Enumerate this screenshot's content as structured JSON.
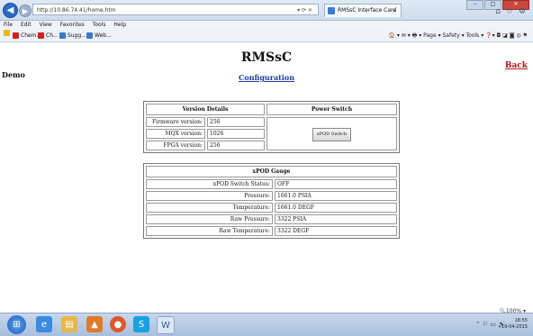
{
  "browser": {
    "url": "http://10.86.74.41/home.htm",
    "tab_title": "RMSsC Interface Card",
    "menu": [
      "File",
      "Edit",
      "View",
      "Favorites",
      "Tools",
      "Help"
    ],
    "favorites": [
      "Chem...",
      "Ch...",
      "Sugg...",
      "Web..."
    ],
    "commands": [
      "Page",
      "Safety",
      "Tools"
    ],
    "zoom": "100%"
  },
  "page": {
    "title": "RMSsC",
    "left_label": "Demo",
    "config_link": "Configuration",
    "back_link": "Back",
    "version_table": {
      "header_left": "Version Details",
      "header_right": "Power Switch",
      "rows": [
        {
          "label": "Firmware version:",
          "value": "256"
        },
        {
          "label": "MQX version:",
          "value": "1026"
        },
        {
          "label": "FPGA version:",
          "value": "256"
        }
      ],
      "switch_button": "xPOD Switch"
    },
    "gauge_table": {
      "header": "xPOD Gauge",
      "rows": [
        {
          "label": "xPOD Switch Status:",
          "value": "OFF"
        },
        {
          "label": "Pressure:",
          "value": "1661.0 PSIA"
        },
        {
          "label": "Temperature:",
          "value": "1661.0 DEGF"
        },
        {
          "label": "Raw Pressure:",
          "value": "3322 PSIA"
        },
        {
          "label": "Raw Temperature:",
          "value": "3322 DEGF"
        }
      ]
    }
  },
  "taskbar": {
    "time": "18:55",
    "date": "19-04-2015"
  }
}
